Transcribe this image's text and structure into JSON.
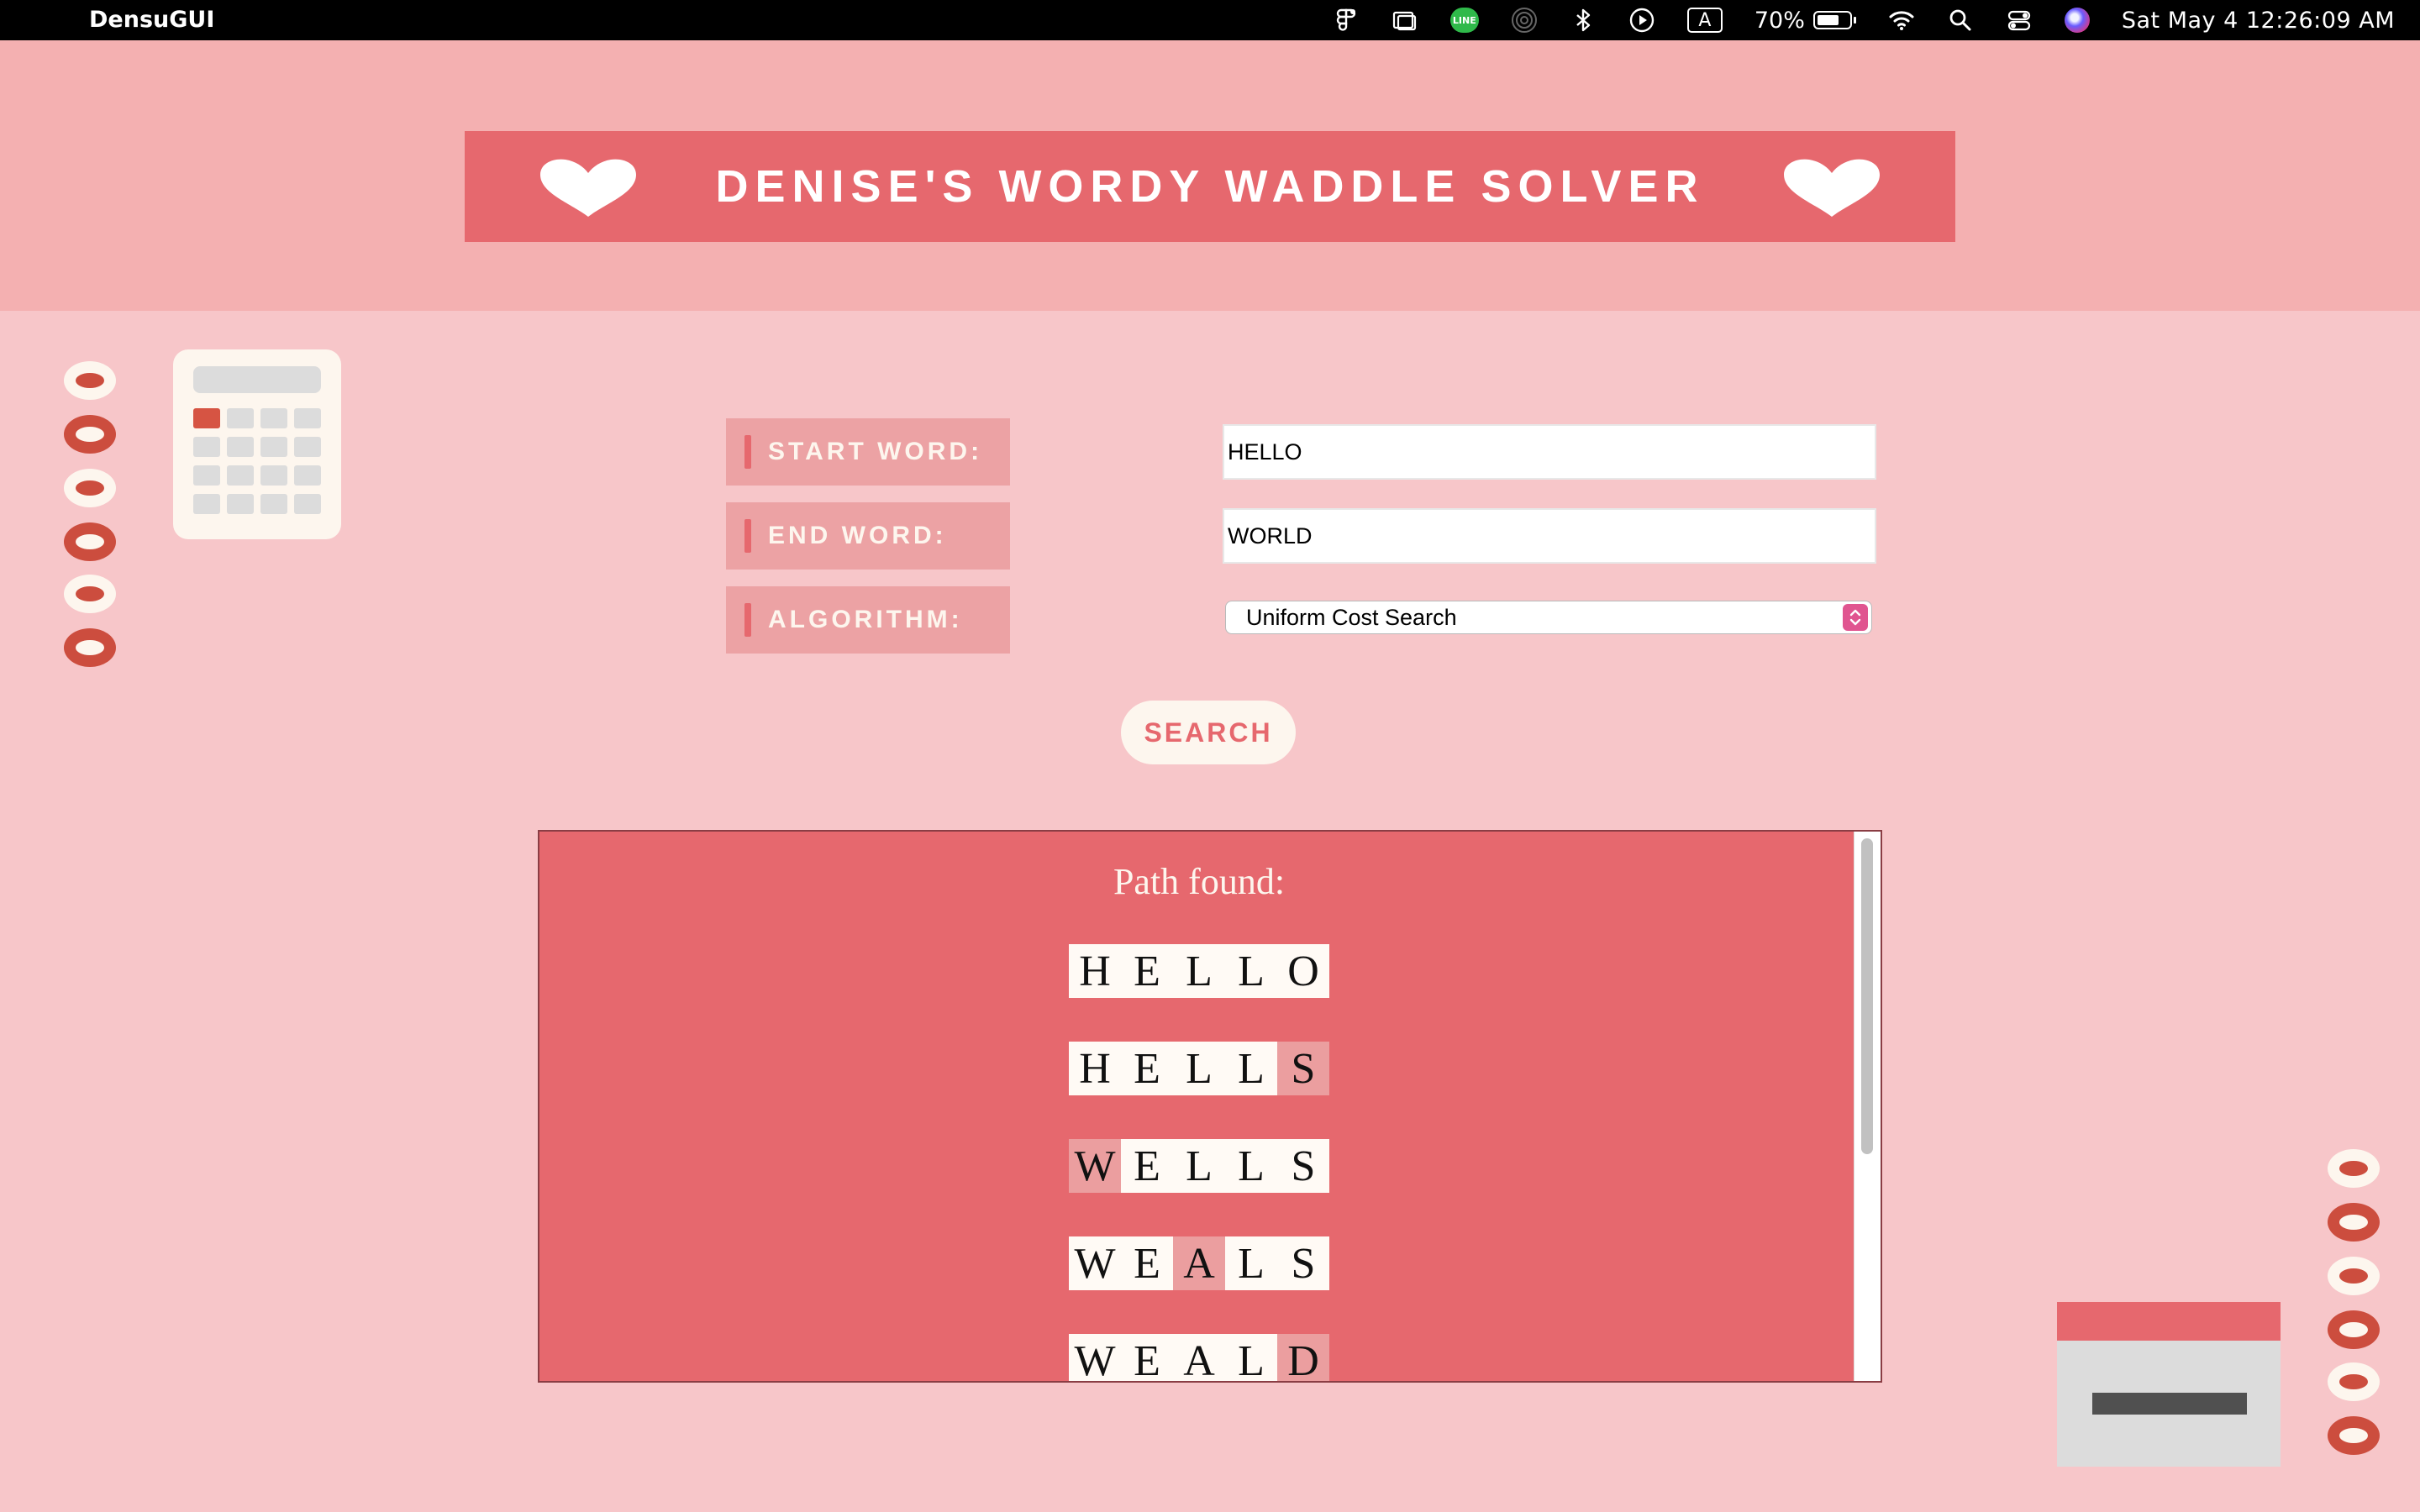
{
  "menubar": {
    "app_name": "DensuGUI",
    "battery_percent": "70%",
    "battery_level": 0.7,
    "input_source": "A",
    "line_label": "LINE",
    "datetime": "Sat May 4  12:26:09 AM"
  },
  "header": {
    "title": "DENISE'S WORDY WADDLE SOLVER"
  },
  "form": {
    "start_label": "START WORD:",
    "start_value": "HELLO",
    "end_label": "END WORD:",
    "end_value": "WORLD",
    "algorithm_label": "ALGORITHM:",
    "algorithm_value": "Uniform Cost Search",
    "search_label": "SEARCH"
  },
  "results": {
    "title": "Path found:",
    "path": [
      {
        "letters": [
          "H",
          "E",
          "L",
          "L",
          "O"
        ],
        "changed": []
      },
      {
        "letters": [
          "H",
          "E",
          "L",
          "L",
          "S"
        ],
        "changed": [
          4
        ]
      },
      {
        "letters": [
          "W",
          "E",
          "L",
          "L",
          "S"
        ],
        "changed": [
          0
        ]
      },
      {
        "letters": [
          "W",
          "E",
          "A",
          "L",
          "S"
        ],
        "changed": [
          2
        ]
      },
      {
        "letters": [
          "W",
          "E",
          "A",
          "L",
          "D"
        ],
        "changed": [
          4
        ]
      }
    ]
  },
  "colors": {
    "page_bg": "#f7c6c9",
    "header_bg": "#f4b0b1",
    "accent": "#e6686e",
    "cream": "#fdf6ee",
    "ring_red": "#cc4d3e",
    "changed_tile": "#eb9e9f"
  },
  "icons": [
    "apple-icon",
    "figma-icon",
    "window-icon",
    "line-icon",
    "airdrop-icon",
    "bluetooth-icon",
    "play-icon",
    "input-source-icon",
    "battery-icon",
    "wifi-icon",
    "search-icon",
    "control-center-icon",
    "siri-icon",
    "heart-icon",
    "calculator-icon"
  ]
}
